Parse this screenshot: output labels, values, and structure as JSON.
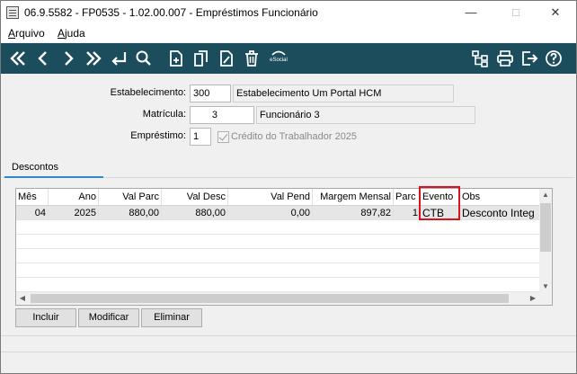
{
  "window": {
    "title": "06.9.5582 - FP0535 - 1.02.00.007 - Empréstimos Funcionário"
  },
  "menu": {
    "items": [
      {
        "label": "Arquivo"
      },
      {
        "label": "Ajuda"
      }
    ]
  },
  "toolbar": {
    "esocial_label": "eSocial"
  },
  "form": {
    "estabelecimento_label": "Estabelecimento:",
    "estabelecimento_code": "300",
    "estabelecimento_name": "Estabelecimento Um Portal HCM",
    "matricula_label": "Matrícula:",
    "matricula_code": "3",
    "matricula_name": "Funcionário 3",
    "emprestimo_label": "Empréstimo:",
    "emprestimo_value": "1",
    "credito_label": "Crédito do Trabalhador 2025",
    "credito_checked": true
  },
  "tabs": [
    {
      "label": "Descontos",
      "active": true
    }
  ],
  "grid": {
    "columns": [
      "Mês",
      "Ano",
      "Val Parc",
      "Val Desc",
      "Val Pend",
      "Margem Mensal",
      "Parc",
      "Evento",
      "Obs"
    ],
    "rows": [
      [
        "04",
        "2025",
        "880,00",
        "880,00",
        "0,00",
        "897,82",
        "1",
        "CTB",
        "Desconto Integ"
      ]
    ]
  },
  "buttons": {
    "incluir": "Incluir",
    "modificar": "Modificar",
    "eliminar": "Eliminar"
  },
  "colors": {
    "toolbar_bg": "#1c4d5c",
    "highlight": "#d9131f",
    "tab_accent": "#2e89c8"
  }
}
